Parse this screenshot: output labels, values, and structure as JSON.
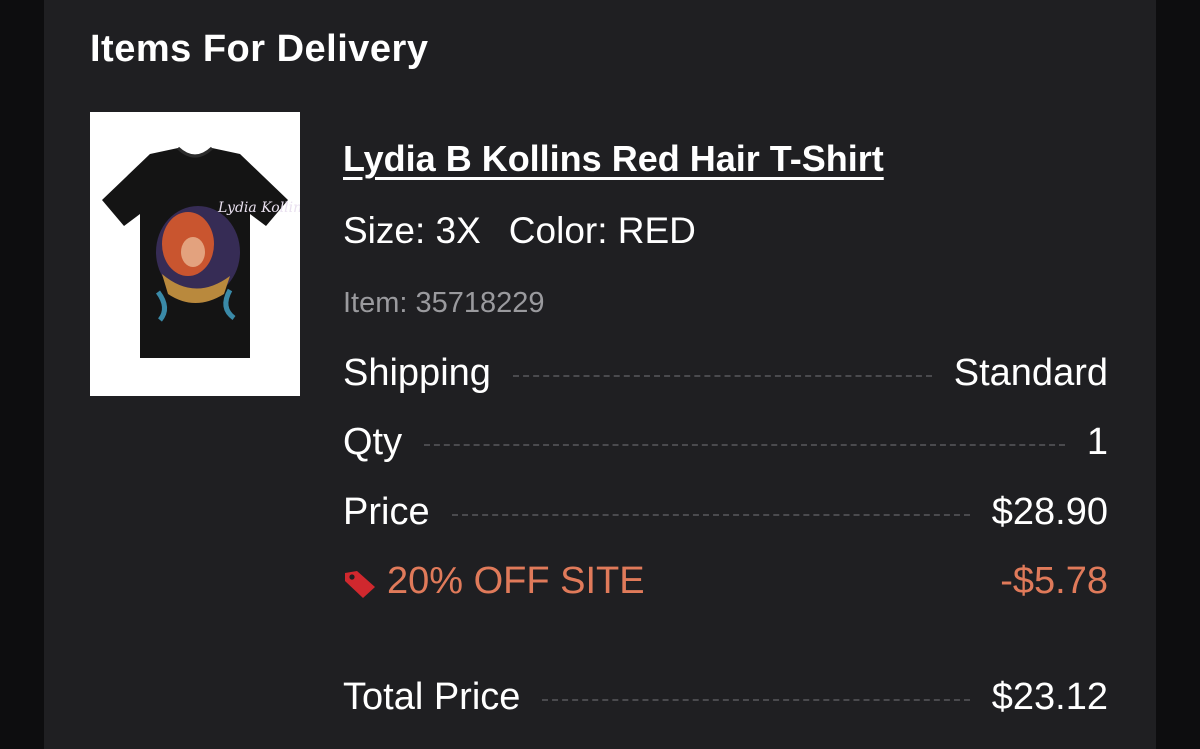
{
  "section": {
    "title": "Items For Delivery"
  },
  "item": {
    "image_alt": "Lydia B Kollins Red Hair T-Shirt",
    "image_text": "Lydia Kollins",
    "name": "Lydia B Kollins Red Hair T-Shirt",
    "size_label": "Size: 3X",
    "color_label": "Color: RED",
    "item_number": "Item: 35718229"
  },
  "summary": {
    "shipping": {
      "label": "Shipping",
      "value": "Standard"
    },
    "qty": {
      "label": "Qty",
      "value": "1"
    },
    "price": {
      "label": "Price",
      "value": "$28.90"
    },
    "discount": {
      "label": "20% OFF SITE",
      "value": "-$5.78",
      "icon": "tag-icon"
    },
    "total": {
      "label": "Total Price",
      "value": "$23.12"
    }
  },
  "colors": {
    "background": "#1f1f22",
    "text": "#ffffff",
    "muted": "#9a9a9e",
    "discount": "#e07a5a",
    "tag": "#d0282e"
  }
}
